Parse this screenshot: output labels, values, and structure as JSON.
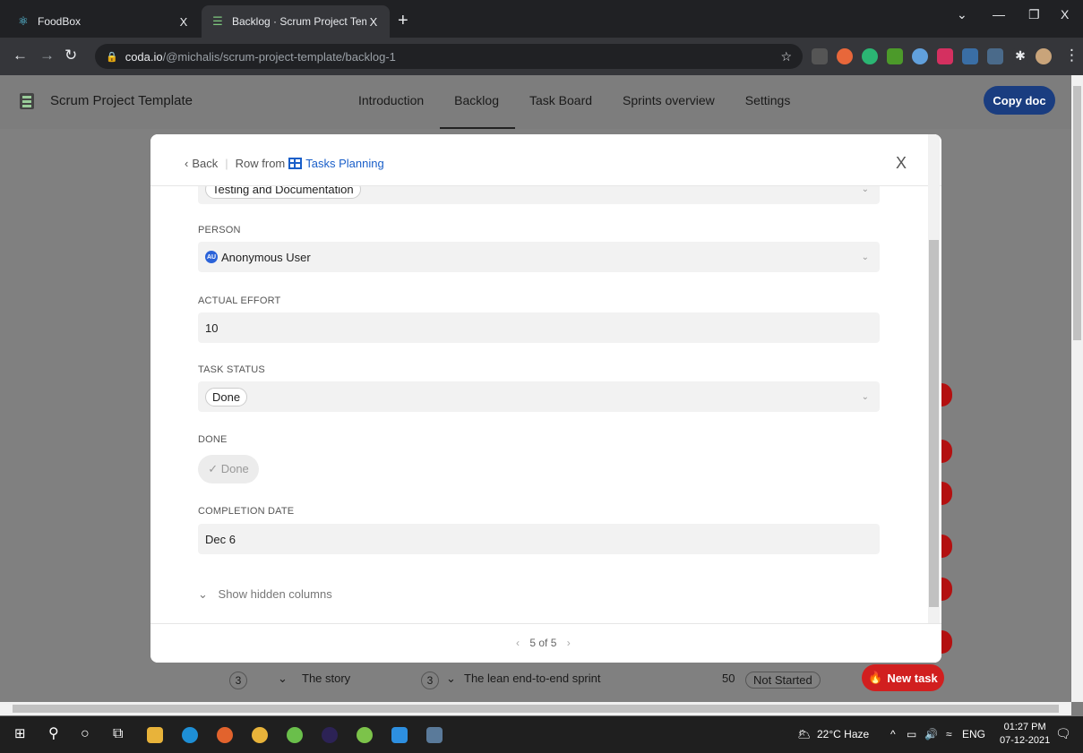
{
  "browser": {
    "tabs": [
      {
        "label": "FoodBox",
        "close": "X",
        "icon": "react-icon"
      },
      {
        "label": "Backlog · Scrum Project Template",
        "close": "X",
        "icon": "coda-icon"
      }
    ],
    "new_tab": "+",
    "window_controls": {
      "dropdown": "⌄",
      "minimize": "—",
      "maximize": "❐",
      "close": "X"
    },
    "url_host": "coda.io",
    "url_path": "/@michalis/scrum-project-template/backlog-1"
  },
  "app": {
    "doc_title": "Scrum Project Template",
    "nav": [
      "Introduction",
      "Backlog",
      "Task Board",
      "Sprints overview",
      "Settings"
    ],
    "copy_doc": "Copy doc"
  },
  "modal": {
    "back": "Back",
    "row_from": "Row from",
    "table_name": "Tasks Planning",
    "close": "X",
    "partial_field_value": "Testing and Documentation",
    "fields": {
      "person_label": "PERSON",
      "person_value": "Anonymous User",
      "person_initials": "AU",
      "actual_effort_label": "ACTUAL EFFORT",
      "actual_effort_value": "10",
      "task_status_label": "TASK STATUS",
      "task_status_value": "Done",
      "done_label": "DONE",
      "done_value": "✓ Done",
      "completion_date_label": "COMPLETION DATE",
      "completion_date_value": "Dec 6"
    },
    "show_hidden": "Show hidden columns",
    "pager": "5 of 5"
  },
  "background_row": {
    "count1": "3",
    "story": "The story",
    "count2": "3",
    "sprint": "The lean end-to-end sprint",
    "effort": "50",
    "status": "Not Started",
    "new_task": "New task"
  },
  "taskbar": {
    "weather": "22°C  Haze",
    "lang": "ENG",
    "time": "01:27 PM",
    "date": "07-12-2021"
  },
  "colors": {
    "brand_blue": "#1a3d80",
    "link_blue": "#1a5fc9",
    "new_task_red": "#d11f1f"
  }
}
